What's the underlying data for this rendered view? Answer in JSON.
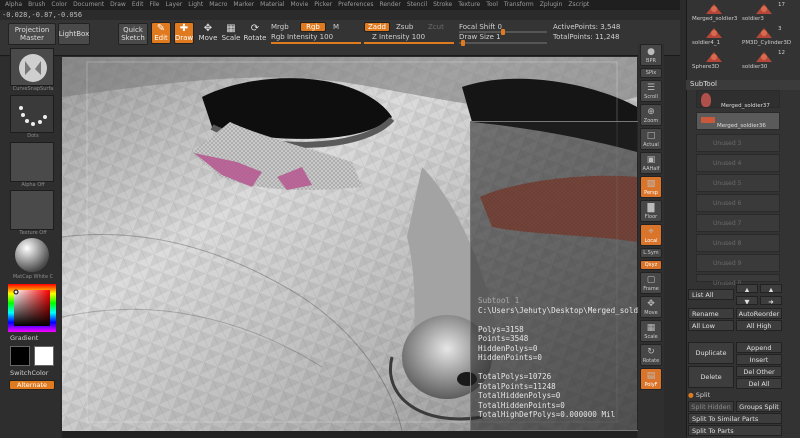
{
  "menu": [
    "Alpha",
    "Brush",
    "Color",
    "Document",
    "Draw",
    "Edit",
    "File",
    "Layer",
    "Light",
    "Macro",
    "Marker",
    "Material",
    "Movie",
    "Picker",
    "Preferences",
    "Render",
    "Stencil",
    "Stroke",
    "Texture",
    "Tool",
    "Transform",
    "Zplugin",
    "Zscript"
  ],
  "coords": "-0.028,-0.87,-0.056",
  "shelf": {
    "projection_master": "Projection\nMaster",
    "lightbox": "LightBox",
    "quick_sketch": "Quick\nSketch",
    "edit": "Edit",
    "draw": "Draw",
    "move": "Move",
    "scale": "Scale",
    "rotate": "Rotate",
    "mrgb": "Mrgb",
    "rgb": "Rgb",
    "m": "M",
    "rgb_intensity": "Rgb Intensity 100",
    "zadd": "Zadd",
    "zsub": "Zsub",
    "zcut": "Zcut",
    "z_intensity": "Z Intensity 100",
    "focal_shift": "Focal Shift 0",
    "draw_size": "Draw Size 1",
    "active_points": "ActivePoints: 3,548",
    "total_points": "TotalPoints: 11,248",
    "rgb_intensity_value": 1.0,
    "z_intensity_value": 1.0,
    "focal_shift_value": 0.5,
    "draw_size_value": 0.02
  },
  "left": {
    "brush_label": "CurveSnapSurfa",
    "stroke_label": "Dots",
    "alpha_label": "Alpha  Off",
    "texture_label": "Texture  Off",
    "material_label": "MatCap  White  C",
    "gradient": "Gradient",
    "switch_color": "SwitchColor",
    "alternate": "Alternate"
  },
  "right_tools": [
    "BPR",
    "SPix",
    "Scroll",
    "Zoom",
    "Actual",
    "AAHalf",
    "Persp",
    "Floor",
    "Local",
    "L.Sym",
    "Qxyz",
    "Frame",
    "Move",
    "Scale",
    "Rotate",
    "PolyF"
  ],
  "info": {
    "title": "Subtool 1",
    "path": "C:\\Users\\Jehuty\\Desktop\\Merged_soldier36",
    "polys": "Polys=3158",
    "points": "Points=3548",
    "hidden_polys": "HiddenPolys=0",
    "hidden_points": "HiddenPoints=0",
    "total_polys": "TotalPolys=10726",
    "total_points": "TotalPoints=11248",
    "total_hidden_polys": "TotalHiddenPolys=0",
    "total_hidden_points": "TotalHiddenPoints=0",
    "total_highdef": "TotalHighDefPolys=0.000000 Mil"
  },
  "palette": {
    "tools": [
      {
        "name": "Merged_soldier3",
        "count": ""
      },
      {
        "name": "soldier3",
        "count": "17"
      },
      {
        "name": "soldier4_1",
        "count": ""
      },
      {
        "name": "PM3D_Cylinder3D",
        "count": "3"
      },
      {
        "name": "Sphere3D",
        "count": ""
      },
      {
        "name": "soldier30",
        "count": "12"
      }
    ],
    "subtool_title": "SubTool",
    "subtools": [
      "Merged_soldier37",
      "Merged_soldier36"
    ],
    "unused": [
      "Unused 3",
      "Unused 4",
      "Unused 5",
      "Unused 6",
      "Unused 7",
      "Unused 8",
      "Unused 9",
      "Unused 0"
    ],
    "list_all": "List All",
    "rename": "Rename",
    "auto_reorder": "AutoReorder",
    "all_low": "All Low",
    "all_high": "All High",
    "duplicate": "Duplicate",
    "append": "Append",
    "insert": "Insert",
    "delete": "Delete",
    "del_other": "Del Other",
    "del_all": "Del All",
    "split": "Split",
    "split_hidden": "Split Hidden",
    "groups_split": "Groups Split",
    "split_similar": "Split To Similar Parts",
    "split_parts": "Split To Parts"
  }
}
